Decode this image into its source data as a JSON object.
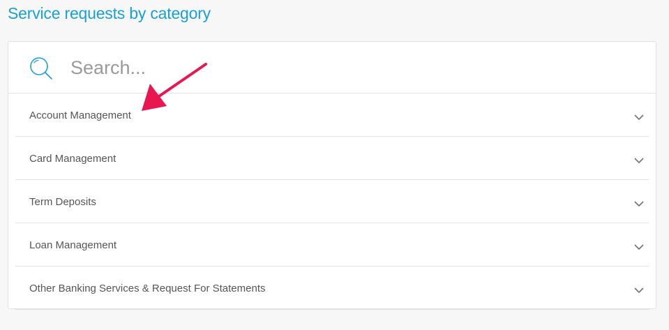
{
  "page": {
    "title": "Service requests by category"
  },
  "search": {
    "placeholder": "Search...",
    "value": "",
    "icon": "search-icon"
  },
  "categories": [
    {
      "label": "Account Management",
      "icon": "chevron-down-icon"
    },
    {
      "label": "Card Management",
      "icon": "chevron-down-icon"
    },
    {
      "label": "Term Deposits",
      "icon": "chevron-down-icon"
    },
    {
      "label": "Loan Management",
      "icon": "chevron-down-icon"
    },
    {
      "label": "Other Banking Services & Request For Statements",
      "icon": "chevron-down-icon"
    }
  ],
  "colors": {
    "accent": "#1aa0d8",
    "annotation_arrow": "#e8174f",
    "label_text": "#555555",
    "divider": "#e3e3e3"
  }
}
